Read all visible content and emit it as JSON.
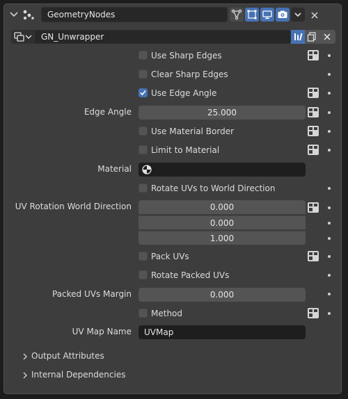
{
  "header": {
    "collapse_icon": "chevron-down-icon",
    "modifier_icon": "geometry-nodes-icon",
    "modifier_name": "GeometryNodes",
    "toggles": [
      "filter-icon",
      "edit-mode-icon",
      "viewport-icon",
      "render-camera-icon"
    ],
    "dropdown_icon": "chevron-down-icon",
    "close_icon": "close-icon"
  },
  "node_group": {
    "name": "GN_Unwrapper",
    "buttons": [
      "fake-user-icon",
      "duplicate-icon",
      "unlink-icon"
    ]
  },
  "inputs": {
    "use_sharp_edges": {
      "label": "Use Sharp Edges",
      "checked": false
    },
    "clear_sharp_edges": {
      "label": "Clear Sharp Edges",
      "checked": false
    },
    "use_edge_angle": {
      "label": "Use Edge Angle",
      "checked": true
    },
    "edge_angle": {
      "label": "Edge Angle",
      "value": "25.000"
    },
    "use_material_border": {
      "label": "Use Material Border",
      "checked": false
    },
    "limit_to_material": {
      "label": "Limit to Material",
      "checked": false
    },
    "material": {
      "label": "Material",
      "value": ""
    },
    "rotate_uvs": {
      "label": "Rotate UVs to World Direction",
      "checked": false
    },
    "uv_rotation": {
      "label": "UV Rotation World Direction",
      "x": "0.000",
      "y": "0.000",
      "z": "1.000"
    },
    "pack_uvs": {
      "label": "Pack UVs",
      "checked": false
    },
    "rotate_packed": {
      "label": "Rotate Packed UVs",
      "checked": false
    },
    "packed_margin": {
      "label": "Packed UVs Margin",
      "value": "0.000"
    },
    "method": {
      "label": "Method",
      "checked": false
    },
    "uv_map_name": {
      "label": "UV Map Name",
      "value": "UVMap"
    }
  },
  "subpanels": {
    "output_attributes": "Output Attributes",
    "internal_dependencies": "Internal Dependencies"
  },
  "colors": {
    "accent": "#4772b3",
    "panel": "#3d3d3d",
    "field": "#545454"
  }
}
